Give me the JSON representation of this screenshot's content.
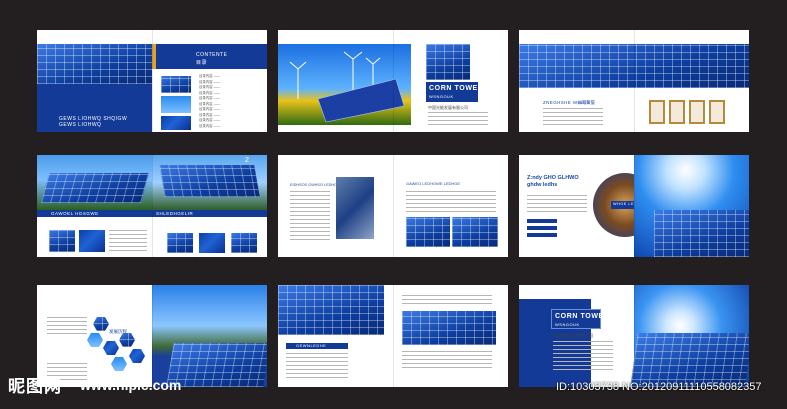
{
  "spreads": {
    "s1": {
      "caption": "GEWS LIOHWQ SHQIGW\nGEWS LIOHWQ",
      "contents_title": "CONTENTE",
      "contents_cn": "目录",
      "toc": [
        "目录内容 ——",
        "目录内容 ——",
        "目录内容 ——",
        "目录内容 ——",
        "目录内容 ——",
        "目录内容 ——",
        "目录内容 ——",
        "目录内容 ——",
        "目录内容 ——",
        "目录内容 ——"
      ]
    },
    "s2": {
      "title": "CORN TOWEN",
      "subtitle": "WSNGOUK",
      "cn_title": "中国光能发展有限公司"
    },
    "s3": {
      "heading": "ZNEGHSHE WINGS",
      "cn_heading": "公司荣誉"
    },
    "s4": {
      "left_caption": "GAWOEL HGSGWE",
      "right_caption": "SHLEDHGELIR",
      "page_no": "2"
    },
    "s5": {
      "left_heading": "EIDHSOS GWHSO LEDHOSW",
      "right_heading": "GAWEO LEDHOWE LEDHGE"
    },
    "s6": {
      "heading_line1": "Z:ndy GHO GLHWO",
      "heading_line2": "ghdw ledhs",
      "badge": "WHGE LEOS"
    },
    "s7": {
      "cn_heading": "发展历程"
    },
    "s8": {
      "heading": "GEWNLEDHE"
    },
    "s9": {
      "title": "CORN TOWEN",
      "subtitle": "WSNGOUK",
      "cn_title": "中国光能发展有限公司"
    }
  },
  "watermark": {
    "logo": "昵图网",
    "url": "www.nipic.com",
    "id": "ID:10303738 NO:20120911110558082357"
  },
  "colors": {
    "background": "#231f20",
    "accent_blue": "#143a97",
    "accent_gold": "#e0a02a"
  }
}
